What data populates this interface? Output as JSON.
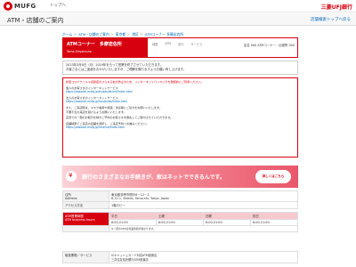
{
  "brand": {
    "logo_text": "MUFG",
    "home_link": "トップへ",
    "bank_name": "三菱UFJ銀行"
  },
  "page": {
    "title": "ATM・店舗のご案内",
    "actions": [
      "店舗検索トップへ戻る"
    ]
  },
  "breadcrumb": [
    "ホーム",
    "ATM・店舗のご案内",
    "東京都",
    "港区",
    "ATMコーナー 多摩岩佐所"
  ],
  "header": {
    "name": "ATMコーナー　多摩岩佐所",
    "subtitle": "Tama-Shiyakusho",
    "mid_links": [
      "地図",
      "ATM",
      "窓口",
      "サービス"
    ],
    "branch_code": "店名 000 ATMコーナー・出張所 000"
  },
  "notice": {
    "lines": [
      "2023年3月6日（月）2019年をもって営業を終了させていただきます。",
      "お客さまにはご迷惑をおかけいたしますが、ご理解を賜りますようお願い申し上げます。"
    ]
  },
  "info": {
    "red_head": "新型コロナウイルス感染症のさらなる拡大防止のため、インターネットバンキングを積極的にご利用ください。",
    "lines": [
      "個人のお客さまのインターネットサービス",
      "https://www.bk.mufg.jp/tsukau/direct/index.html",
      "法人のお客さまのインターネットサービス",
      "https://www.bk.mufg.jp/houjin/eb/index.html",
      "また、ご来店時は、マスク着用や検温・消毒等にご協力をお願いいたします。",
      "不要不急の来店を避けるようお願いいたします。",
      "店頭での一部のお取引を除きご予約のお客さまを優先してご案内させていただきます。",
      "店舗検索でご来店の店舗を選択し、ご来店予約へお進みください。",
      "https://www.bk.mufg.jp/reserve/index.html"
    ]
  },
  "banner": {
    "text": "銀行のさまざまなお手続きが、家はネットでできるんです。",
    "button": "詳しくはこちら"
  },
  "address": {
    "label": "住所",
    "label_en": "Address",
    "value": "東京都多摩市関戸6－12－1",
    "value_en": "6-12-1, Sekido, Tama-shi, Tokyo, Japan",
    "access_label": "アクセス方法",
    "access_value": "1階ロビー"
  },
  "atm": {
    "label": "ATM営業時間",
    "label_en": "ATM business hours",
    "days": [
      "平日",
      "土曜",
      "日曜",
      "祝日"
    ],
    "hours_label": "8:00-21:00",
    "note": "※一部のATMは営業時間が異なります。"
  },
  "services": {
    "label": "取扱業務／サービス",
    "label_en": "Services",
    "items": [
      "ICキャッシュカード対応ATM設置店",
      "三井住友信託銀行ATM設置店"
    ]
  },
  "colors": {
    "accent": "#d7000f",
    "link": "#0068b7"
  }
}
